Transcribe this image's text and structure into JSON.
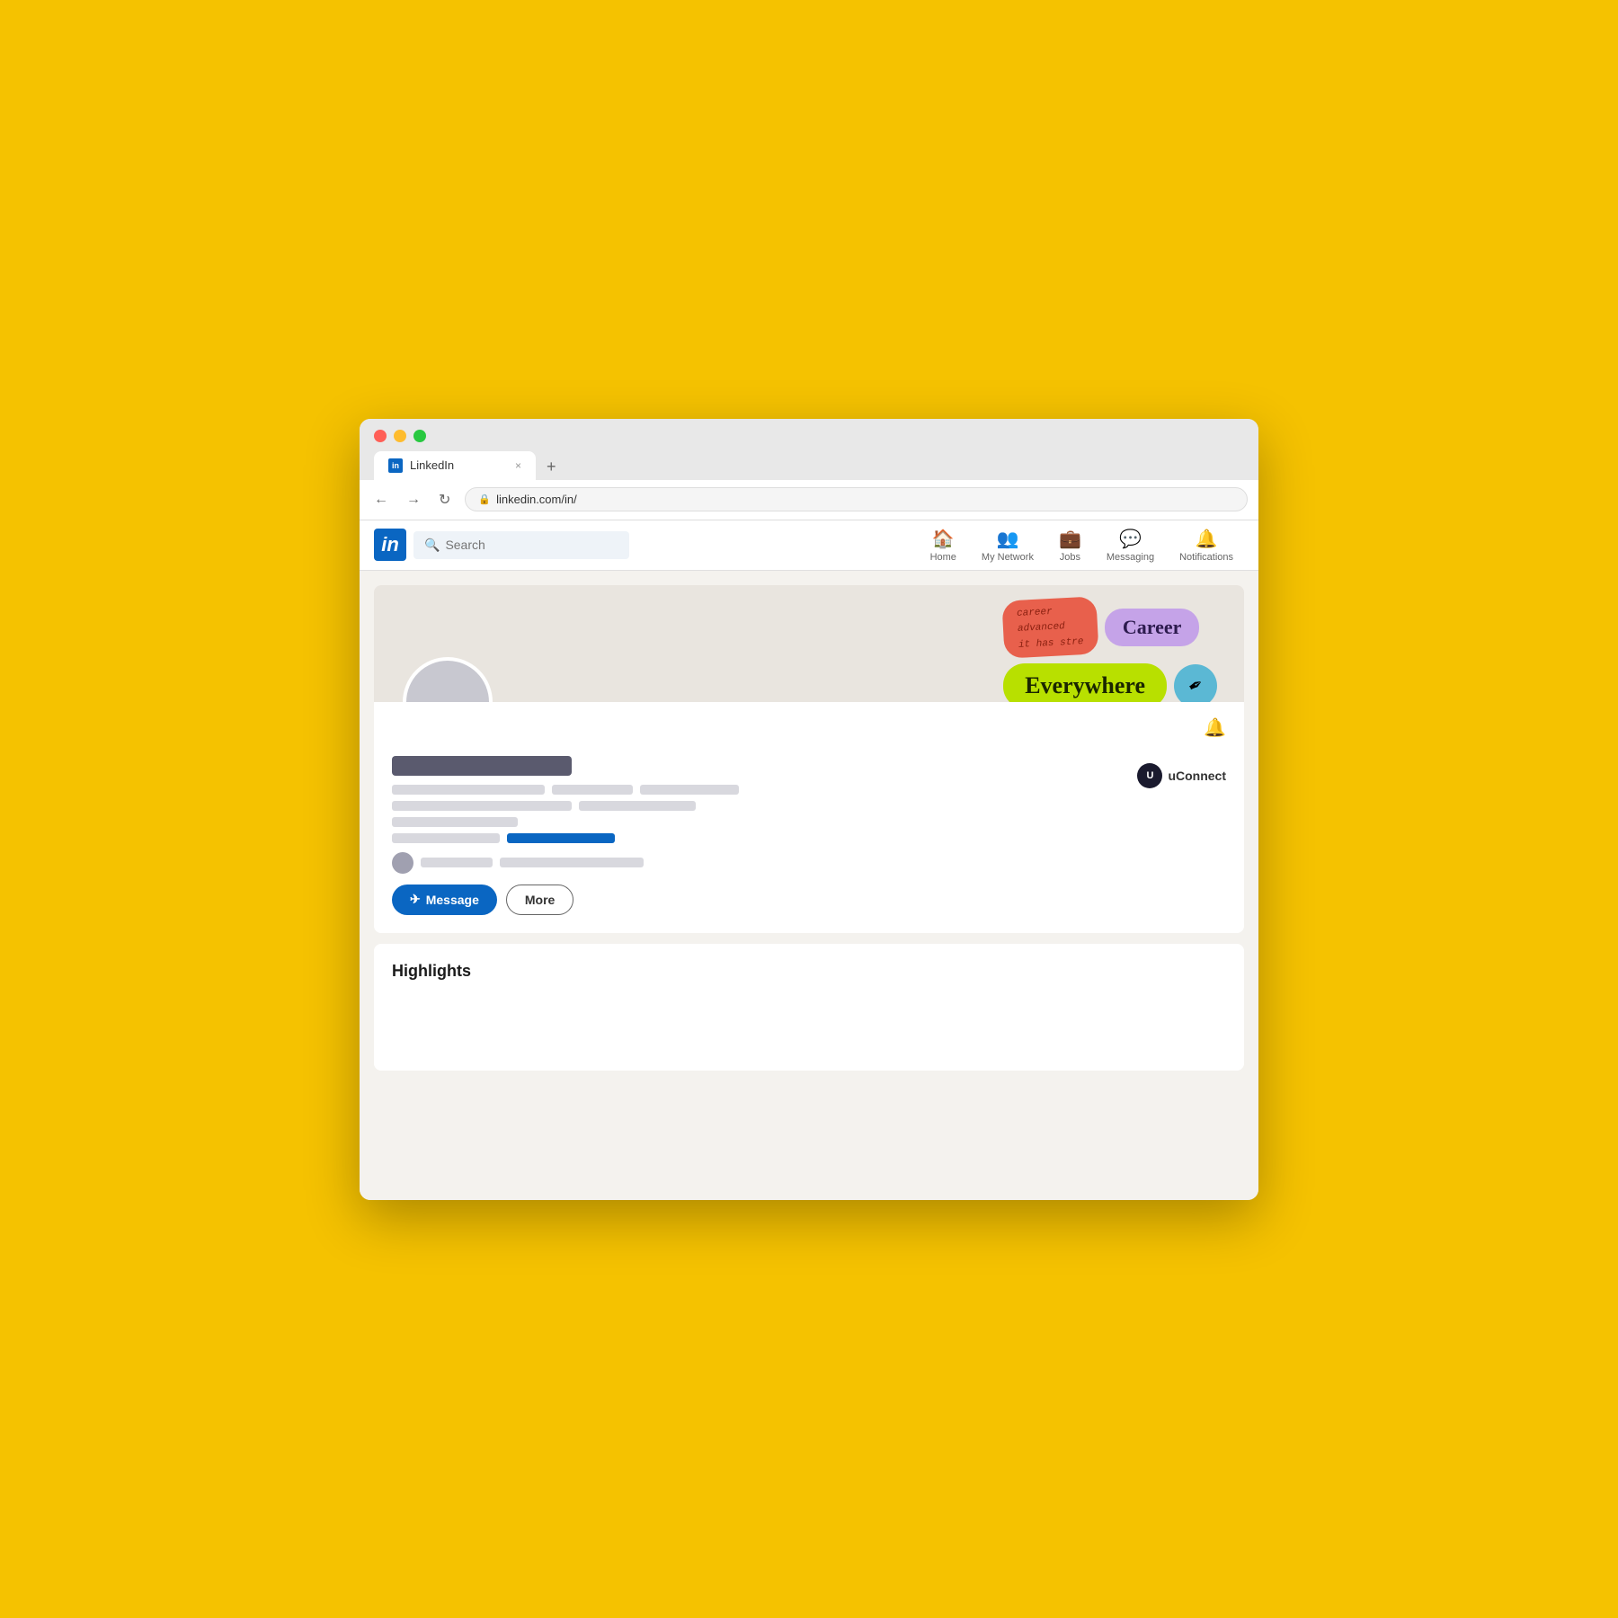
{
  "browser": {
    "tab_title": "LinkedIn",
    "tab_favicon": "in",
    "new_tab_label": "+",
    "close_tab_label": "×",
    "url": "linkedin.com/in/",
    "nav": {
      "back_label": "←",
      "forward_label": "→",
      "refresh_label": "↻"
    }
  },
  "linkedin": {
    "logo_text": "in",
    "search_placeholder": "Search",
    "nav_items": [
      {
        "id": "home",
        "icon": "🏠",
        "label": "Home"
      },
      {
        "id": "my-network",
        "icon": "👥",
        "label": "My Network"
      },
      {
        "id": "jobs",
        "icon": "💼",
        "label": "Jobs"
      },
      {
        "id": "messaging",
        "icon": "💬",
        "label": "Messaging"
      },
      {
        "id": "notifications",
        "icon": "🔔",
        "label": "Notifications"
      }
    ]
  },
  "profile": {
    "bell_icon": "🔔",
    "uconnect_logo": "U",
    "uconnect_name": "uConnect",
    "message_btn": "Message",
    "message_icon": "✈",
    "more_btn": "More",
    "highlights_title": "Highlights"
  },
  "stickers": {
    "coral_text": "career\nadvanced\nit has stre",
    "purple_text": "Career",
    "green_text": "Everywhere",
    "pen_icon": "✒"
  },
  "colors": {
    "background": "#F5C200",
    "linkedin_blue": "#0a66c2",
    "sticker_coral": "#e8604c",
    "sticker_purple": "#c5a3e8",
    "sticker_green": "#b8e000",
    "sticker_teal": "#5bb8d4"
  }
}
